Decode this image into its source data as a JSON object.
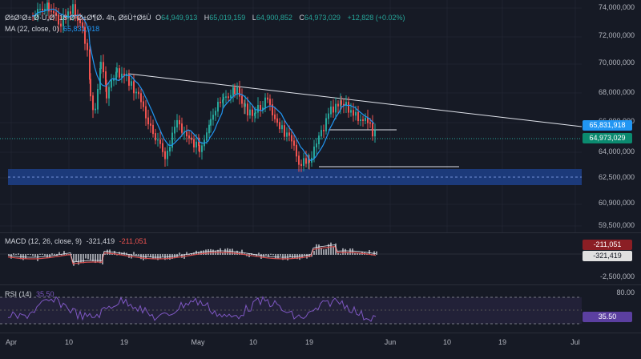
{
  "header": {
    "symbol": "ØšØ¹Ø± Ø·Ù„Ø¨ 18 Ø¹Ø±Ø¶Ø، 4h, ØšÙ†ØšÙ",
    "open_label": "O",
    "open": "64,949,913",
    "high_label": "H",
    "high": "65,019,159",
    "low_label": "L",
    "low": "64,900,852",
    "close_label": "C",
    "close": "64,973,029",
    "change": "+12,828 (+0.02%)"
  },
  "ma": {
    "label": "MA (22, close, 0)",
    "value": "65,831,918"
  },
  "price_axis": {
    "labels": [
      "74,000,000",
      "72,000,000",
      "70,000,000",
      "68,000,000",
      "66,000,000",
      "64,000,000",
      "62,500,000",
      "60,900,000",
      "59,500,000"
    ]
  },
  "price_tags": {
    "ma": "65,831,918",
    "close": "64,973,029"
  },
  "macd": {
    "label": "MACD (12, 26, close, 9)",
    "value1": "-321,419",
    "value2": "-211,051",
    "tag1": "-211,051",
    "tag2": "-321,419",
    "axis_label": "-2,500,000"
  },
  "rsi": {
    "label": "RSI (14)",
    "value": "35.50",
    "axis_top": "80.00",
    "tag": "35.50"
  },
  "time_axis": {
    "labels": [
      "Apr",
      "10",
      "19",
      "May",
      "10",
      "19",
      "Jun",
      "10",
      "19",
      "Jul"
    ]
  },
  "colors": {
    "background": "#161a25",
    "up": "#26a69a",
    "down": "#ef5350",
    "ma_line": "#2196f3",
    "zone": "#1c3a7a",
    "rsi_line": "#7e57c2",
    "macd_line": "#d84f4f"
  }
}
